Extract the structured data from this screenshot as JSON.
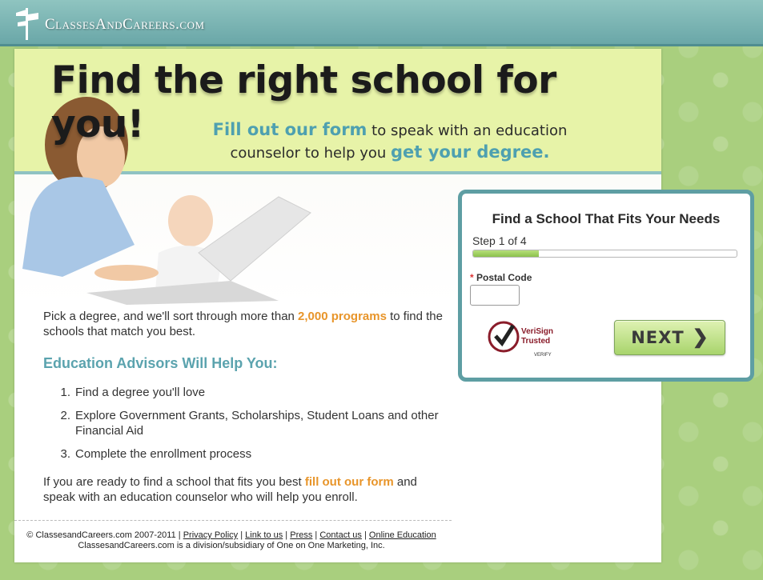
{
  "header": {
    "logo_text": "ClassesAndCareers.com"
  },
  "hero": {
    "headline": "Find the right school for you!",
    "sub_part1": "Fill out our form",
    "sub_part2": " to speak with an education counselor to help you ",
    "sub_part3": "get your degree."
  },
  "intro": {
    "part1": "Pick a degree, and we'll sort through more than ",
    "programs": "2,000 programs",
    "part2": " to find the schools that match you best."
  },
  "advisors_heading": "Education Advisors Will Help You:",
  "steps": [
    {
      "num": "1.",
      "text": "Find a degree you'll love"
    },
    {
      "num": "2.",
      "text": "Explore Government Grants, Scholarships, Student Loans and other Financial Aid"
    },
    {
      "num": "3.",
      "text": "Complete the enrollment process"
    }
  ],
  "closing": {
    "part1": "If you are ready to find a school that fits you best ",
    "link": "fill out our form",
    "part2": " and speak with an education counselor who will help you enroll."
  },
  "footer": {
    "copyright": "© ClassesandCareers.com 2007-2011 |",
    "links": [
      "Privacy Policy",
      "Link to us",
      "Press",
      "Contact us",
      "Online Education"
    ],
    "line2": "ClassesandCareers.com is a division/subsidiary of One on One Marketing, Inc."
  },
  "form": {
    "title": "Find a School That Fits Your Needs",
    "step_text": "Step 1 of 4",
    "progress": 0.25,
    "required_mark": "*",
    "postal_label": "Postal Code",
    "postal_value": "",
    "verisign": {
      "line1": "VeriSign",
      "line2": "Trusted",
      "line3": "VERIFY"
    },
    "next_label": "NEXT"
  },
  "colors": {
    "accent_teal": "#5ba3ae",
    "accent_orange": "#e8952a",
    "background_green": "#a9cf7e",
    "hero_yellow": "#e7f3a8"
  }
}
